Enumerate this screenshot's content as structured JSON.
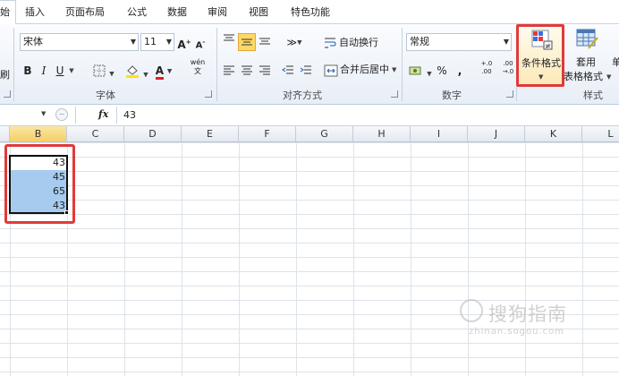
{
  "tabs": {
    "active_fragment": "始",
    "items": [
      "插入",
      "页面布局",
      "公式",
      "数据",
      "审阅",
      "视图",
      "特色功能"
    ]
  },
  "ribbon": {
    "font_group": {
      "label": "字体",
      "font_name": "宋体",
      "font_size": "11",
      "left_edge_glyph": "刷",
      "bold": "B",
      "italic": "I",
      "underline": "U",
      "wen": "wén\n文"
    },
    "align_group": {
      "label": "对齐方式",
      "wrap_text": "自动换行",
      "merge_center": "合并后居中"
    },
    "number_group": {
      "label": "数字",
      "format": "常规",
      "percent": "%",
      "comma": ",",
      "inc_decimal": "+.0\n.00",
      "dec_decimal": ".00\n→.0"
    },
    "style_group": {
      "label": "样式",
      "conditional_format": "条件格式",
      "table_format_line1": "套用",
      "table_format_line2": "表格格式",
      "cell_style_fragment": "单"
    }
  },
  "formula_bar": {
    "fx": "fx",
    "value": "43"
  },
  "sheet": {
    "columns": [
      "B",
      "C",
      "D",
      "E",
      "F",
      "G",
      "H",
      "I",
      "J",
      "K",
      "L"
    ],
    "selected_column": "B",
    "cells": [
      "43",
      "45",
      "65",
      "43"
    ]
  },
  "watermark": {
    "text": "搜狗指南",
    "url": "zhinan.sogou.com"
  },
  "colors": {
    "highlight_red": "#e03a3a",
    "selection_fill": "#a6cbee",
    "selected_header": "#f4cf6a"
  }
}
